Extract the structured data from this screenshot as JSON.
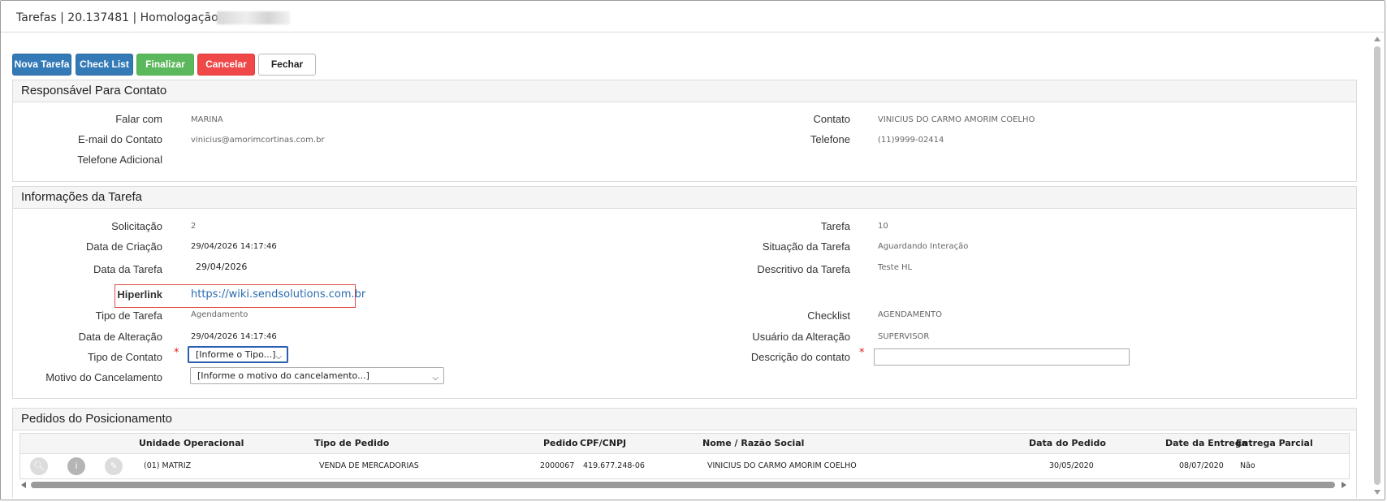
{
  "window": {
    "title": "Tarefas | 20.137481 | Homologação |"
  },
  "toolbar": {
    "nova_tarefa": "Nova Tarefa",
    "check_list": "Check List",
    "finalizar": "Finalizar",
    "cancelar": "Cancelar",
    "fechar": "Fechar"
  },
  "contato": {
    "heading": "Responsável Para Contato",
    "falar_com_label": "Falar com",
    "falar_com_value": "MARINA",
    "email_label": "E-mail do Contato",
    "email_value": "vinicius@amorimcortinas.com.br",
    "tel_adicional_label": "Telefone Adicional",
    "contato_label": "Contato",
    "contato_value": "VINICIUS DO CARMO AMORIM COELHO",
    "telefone_label": "Telefone",
    "telefone_value": "(11)9999-02414"
  },
  "tarefa": {
    "heading": "Informações da Tarefa",
    "solicitacao_label": "Solicitação",
    "solicitacao_value": "2",
    "data_criacao_label": "Data de Criação",
    "data_criacao_value": "29/04/2026 14:17:46",
    "data_tarefa_label": "Data da Tarefa",
    "data_tarefa_value": "29/04/2026",
    "hiperlink_label": "Hiperlink",
    "hiperlink_value": "https://wiki.sendsolutions.com.br",
    "tipo_tarefa_label": "Tipo de Tarefa",
    "tipo_tarefa_value": "Agendamento",
    "data_alteracao_label": "Data de Alteração",
    "data_alteracao_value": "29/04/2026 14:17:46",
    "tipo_contato_label": "Tipo de Contato",
    "tipo_contato_selected": "[Informe o Tipo...]",
    "motivo_label": "Motivo do Cancelamento",
    "motivo_selected": "[Informe o motivo do cancelamento...]",
    "tarefa_label": "Tarefa",
    "tarefa_value": "10",
    "situacao_label": "Situação da Tarefa",
    "situacao_value": "Aguardando Interação",
    "descritivo_label": "Descritivo da Tarefa",
    "descritivo_value": "Teste HL",
    "checklist_label": "Checklist",
    "checklist_value": "AGENDAMENTO",
    "usuario_label": "Usuário da Alteração",
    "usuario_value": "SUPERVISOR",
    "descricao_contato_label": "Descrição do contato",
    "descricao_contato_value": "",
    "required_mark": "*"
  },
  "pedidos": {
    "heading": "Pedidos do Posicionamento",
    "columns": [
      "Unidade Operacional",
      "Tipo de Pedido",
      "Pedido",
      "CPF/CNPJ",
      "Nome / Razão Social",
      "Data do Pedido",
      "Date da Entrega",
      "Entrega Parcial"
    ],
    "rows": [
      [
        "(01) MATRIZ",
        "VENDA DE MERCADORIAS",
        "2000067",
        "419.677.248-06",
        "VINICIUS DO CARMO AMORIM COELHO",
        "30/05/2020",
        "08/07/2020",
        "Não"
      ]
    ],
    "row_icons": [
      "search-icon",
      "info-icon",
      "edit-icon"
    ]
  },
  "colors": {
    "primary": "#337ab7",
    "success": "#5cb85c",
    "danger": "#f04848",
    "link": "#2a6cae",
    "highlight": "#e34b4b"
  }
}
